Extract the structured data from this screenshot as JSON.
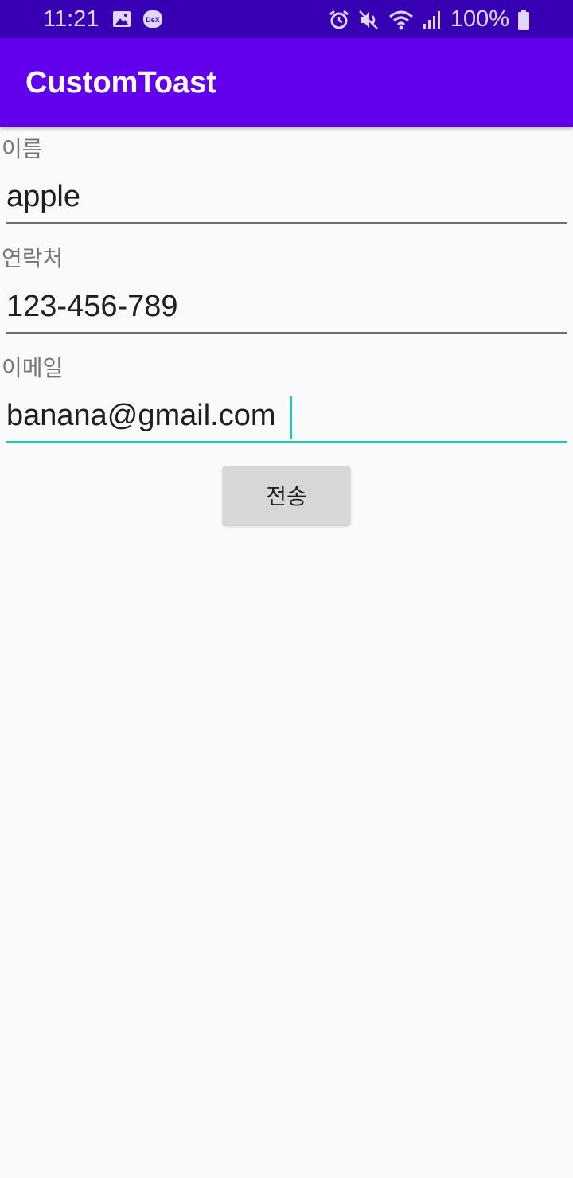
{
  "status_bar": {
    "time": "11:21",
    "battery_percent": "100%",
    "left_icons": [
      "image-icon",
      "dex-icon"
    ],
    "right_icons": [
      "alarm-icon",
      "mute-icon",
      "wifi-icon",
      "signal-icon",
      "battery-icon"
    ],
    "dex_text": "DeX"
  },
  "app_bar": {
    "title": "CustomToast",
    "color": "#6200ee"
  },
  "form": {
    "name_label": "이름",
    "name_value": "apple",
    "phone_label": "연락처",
    "phone_value": "123-456-789",
    "email_label": "이메일",
    "email_value": "banana@gmail.com",
    "focus_color": "#1ec8c0"
  },
  "send_button": {
    "label": "전송"
  }
}
